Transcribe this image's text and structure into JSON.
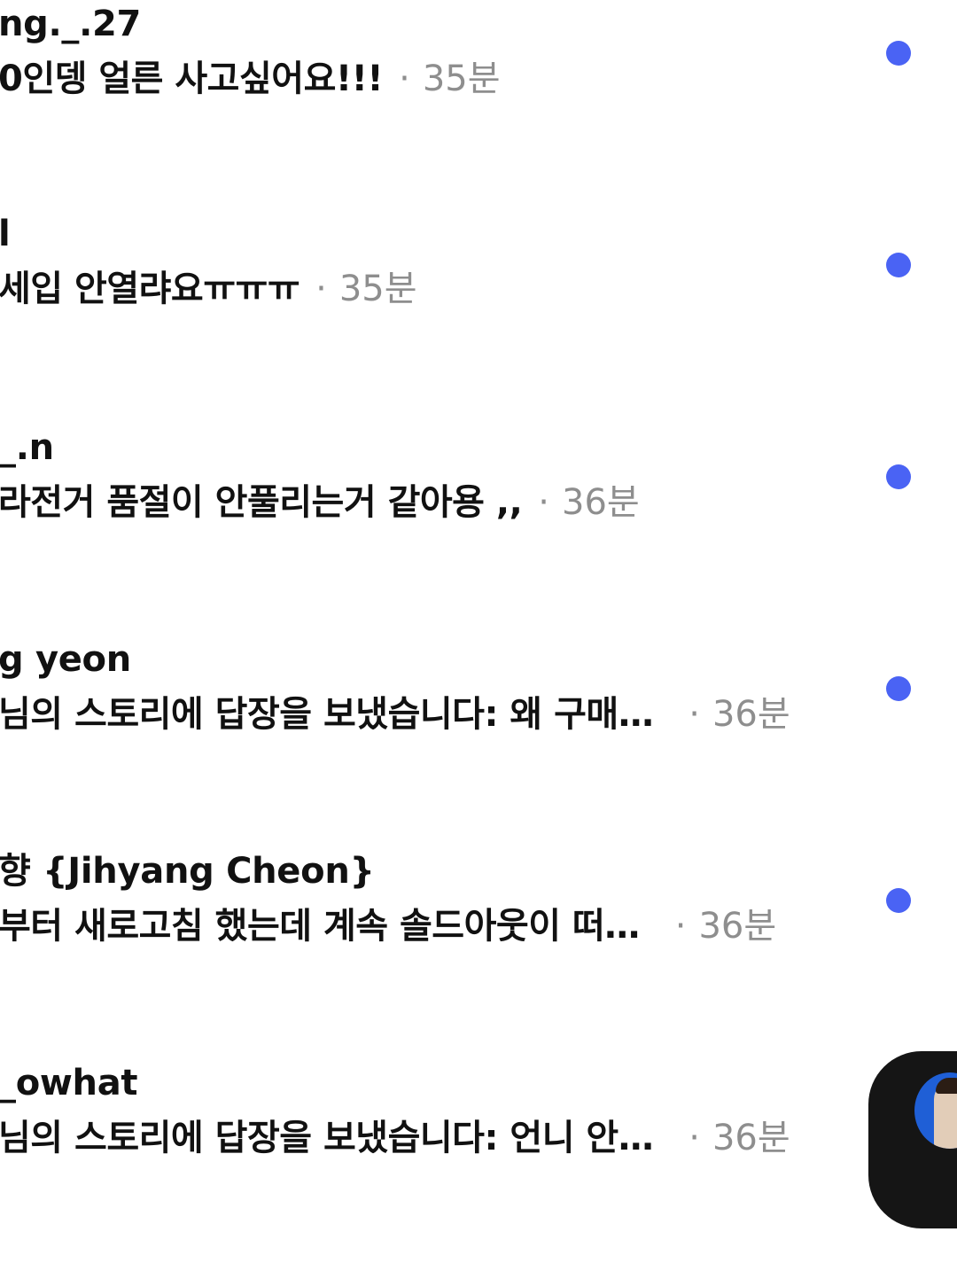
{
  "items": [
    {
      "name": "ng._.27",
      "message": "0인뎅 얼른 사고싶어요!!!",
      "separator": "·",
      "time": "35분",
      "unread": true
    },
    {
      "name": "l",
      "message": "세입 안열랴요ㅠㅠㅠ",
      "separator": "·",
      "time": "35분",
      "unread": true
    },
    {
      "name": "_.n",
      "message": "라전거 품절이 안풀리는거 같아용 ,,",
      "separator": "·",
      "time": "36분",
      "unread": true
    },
    {
      "name": "g yeon",
      "message": "님의 스토리에 답장을 보냈습니다: 왜 구매…",
      "separator": "·",
      "time": "36분",
      "unread": true
    },
    {
      "name": "향 {Jihyang Cheon}",
      "message": "부터 새로고침 했는데 계속 솔드아웃이 떠…",
      "separator": "·",
      "time": "36분",
      "unread": true
    },
    {
      "name": "_owhat",
      "message": "님의 스토리에 답장을 보냈습니다: 언니 안…",
      "separator": "·",
      "time": "36분",
      "unread": true
    }
  ],
  "colors": {
    "unread_dot": "#4a63f4",
    "timestamp": "#8e8e8e",
    "text": "#111111"
  },
  "floating_bubble": {
    "icon": "avatar-photo"
  }
}
